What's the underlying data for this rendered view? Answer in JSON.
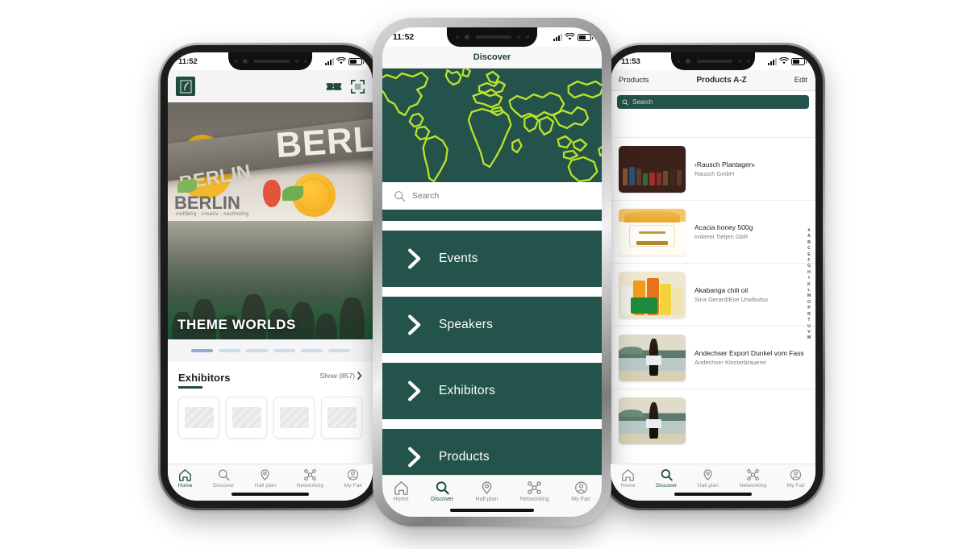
{
  "phones": {
    "home": {
      "status": {
        "time": "11:52"
      },
      "appbar": {
        "logo": "fair-logo",
        "ticket_icon": "ticket-icon",
        "scan_icon": "qr-scan-icon"
      },
      "hero": {
        "banner_text_large": "BERL",
        "banner_text_small": "BERLIN",
        "banner_text_small2": "BERLIN",
        "tagline": "vielfältig · kreativ · nachhaltig",
        "caption": "THEME WORLDS",
        "dots_count": 6,
        "active_dot": 0
      },
      "section": {
        "title": "Exhibitors",
        "more_label": "Show (857)",
        "chevron": "chevron-right-icon",
        "cards": 4
      },
      "tabbar": {
        "active": "Home",
        "items": [
          {
            "label": "Home",
            "icon": "home-icon"
          },
          {
            "label": "Discover",
            "icon": "search-icon"
          },
          {
            "label": "Hall plan",
            "icon": "map-pin-icon"
          },
          {
            "label": "Networking",
            "icon": "network-icon"
          },
          {
            "label": "My Fair",
            "icon": "user-icon"
          }
        ]
      }
    },
    "discover": {
      "status": {
        "time": "11:52"
      },
      "navbar": {
        "title": "Discover"
      },
      "map": {
        "background_color": "#23534A",
        "outline_color": "#BCE22B"
      },
      "search": {
        "placeholder": "Search",
        "icon": "search-icon"
      },
      "menu": [
        {
          "label": "Events",
          "icon": "chevron-right-icon"
        },
        {
          "label": "Speakers",
          "icon": "chevron-right-icon"
        },
        {
          "label": "Exhibitors",
          "icon": "chevron-right-icon"
        },
        {
          "label": "Products",
          "icon": "chevron-right-icon"
        }
      ],
      "tabbar": {
        "active": "Discover",
        "items": [
          {
            "label": "Home",
            "icon": "home-icon"
          },
          {
            "label": "Discover",
            "icon": "search-icon"
          },
          {
            "label": "Hall plan",
            "icon": "map-pin-icon"
          },
          {
            "label": "Networking",
            "icon": "network-icon"
          },
          {
            "label": "My Fair",
            "icon": "user-icon"
          }
        ]
      }
    },
    "products": {
      "status": {
        "time": "11:53"
      },
      "navbar": {
        "back_label": "Products",
        "title": "Products A-Z",
        "edit_label": "Edit"
      },
      "search": {
        "placeholder": "Search",
        "icon": "search-icon"
      },
      "items": [
        {
          "name": "›Rausch Plantagen‹",
          "company": "Rausch GmbH",
          "thumb": "chocolate-shelf-photo"
        },
        {
          "name": "Acacia honey 500g",
          "company": "Imkerei Tietjen GbR",
          "thumb": "honey-jar-photo"
        },
        {
          "name": "Akabanga chili oil",
          "company": "Sina Gerard/Ese Urwibutso",
          "thumb": "chili-oil-bottles-photo"
        },
        {
          "name": "Andechser Export Dunkel vom Fass",
          "company": "Andechser Klosterbrauerei",
          "thumb": "beer-bottle-photo"
        }
      ],
      "az_index": [
        "#",
        "A",
        "B",
        "C",
        "E",
        "F",
        "G",
        "H",
        "I",
        "K",
        "L",
        "M",
        "O",
        "P",
        "R",
        "T",
        "U",
        "V",
        "W"
      ],
      "tabbar": {
        "active": "Discover",
        "items": [
          {
            "label": "Home",
            "icon": "home-icon"
          },
          {
            "label": "Discover",
            "icon": "search-icon"
          },
          {
            "label": "Hall plan",
            "icon": "map-pin-icon"
          },
          {
            "label": "Networking",
            "icon": "network-icon"
          },
          {
            "label": "My Fair",
            "icon": "user-icon"
          }
        ]
      }
    }
  },
  "colors": {
    "brand_green": "#23534A",
    "lime": "#BCE22B",
    "dark_text": "#1B1B1B"
  }
}
